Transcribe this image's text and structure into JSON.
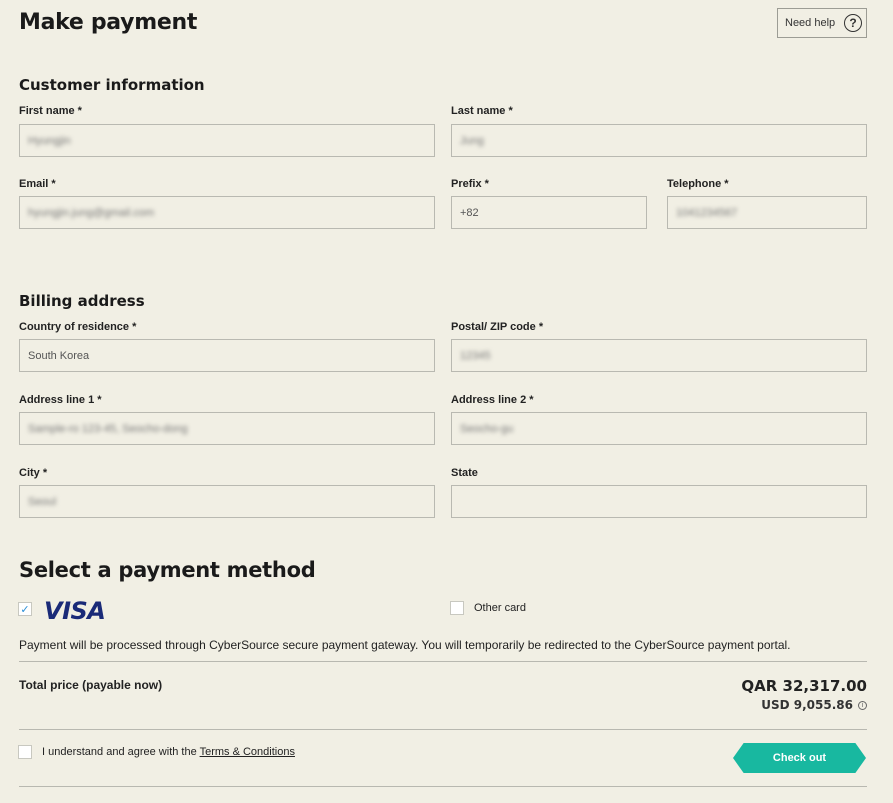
{
  "header": {
    "title": "Make payment",
    "help_label": "Need help",
    "help_glyph": "?"
  },
  "customer": {
    "section_title": "Customer information",
    "first_name_label": "First name *",
    "first_name_value": "Hyungjin",
    "last_name_label": "Last name *",
    "last_name_value": "Jung",
    "email_label": "Email *",
    "email_value": "hyungjin.jung@gmail.com",
    "prefix_label": "Prefix *",
    "prefix_value": "+82",
    "telephone_label": "Telephone *",
    "telephone_value": "1041234567"
  },
  "billing": {
    "section_title": "Billing address",
    "country_label": "Country of residence *",
    "country_value": "South Korea",
    "postal_label": "Postal/ ZIP code *",
    "postal_value": "12345",
    "address1_label": "Address line 1 *",
    "address1_value": "Sample-ro 123-45, Seocho-dong",
    "address2_label": "Address line 2 *",
    "address2_value": "Seocho-gu",
    "city_label": "City *",
    "city_value": "Seoul",
    "state_label": "State",
    "state_value": ""
  },
  "payment": {
    "section_title": "Select a payment method",
    "visa_label": "VISA",
    "visa_check": "✓",
    "other_card_label": "Other card",
    "gateway_message": "Payment will be processed through CyberSource secure payment gateway. You will temporarily be redirected to the CyberSource payment portal."
  },
  "total": {
    "label": "Total price (payable now)",
    "primary": "QAR 32,317.00",
    "secondary": "USD 9,055.86",
    "info_glyph": "i"
  },
  "agreement": {
    "prefix_text": "I understand and agree with the ",
    "link_text": "Terms & Conditions"
  },
  "checkout": {
    "label": "Check out",
    "color": "#18b8a0"
  }
}
